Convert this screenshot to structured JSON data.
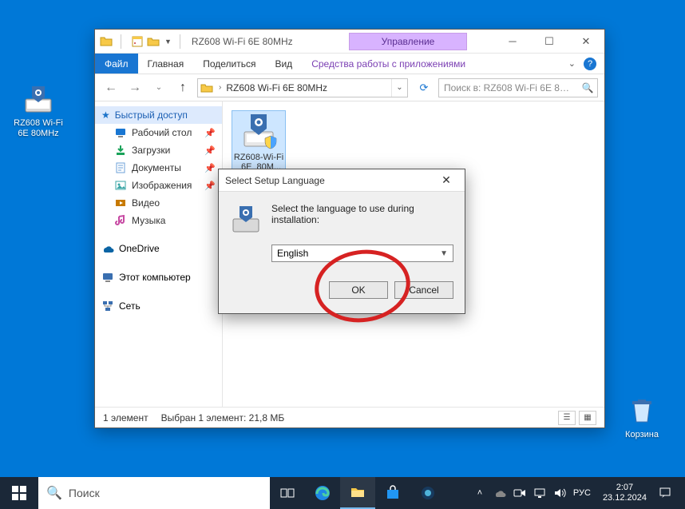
{
  "desktop": {
    "shortcut_label": "RZ608 Wi-Fi 6E 80MHz",
    "recycle_bin_label": "Корзина"
  },
  "explorer": {
    "title": "RZ608 Wi-Fi 6E 80MHz",
    "context_tab_header": "Управление",
    "tabs": {
      "file": "Файл",
      "home": "Главная",
      "share": "Поделиться",
      "view": "Вид",
      "context": "Средства работы с приложениями"
    },
    "address_segment": "RZ608 Wi-Fi 6E 80MHz",
    "search_placeholder": "Поиск в: RZ608 Wi-Fi 6E 80M...",
    "nav": {
      "quick_access": "Быстрый доступ",
      "items": [
        {
          "label": "Рабочий стол",
          "icon": "desktop-icon",
          "color": "#1976d2"
        },
        {
          "label": "Загрузки",
          "icon": "downloads-icon",
          "color": "#1aa35a"
        },
        {
          "label": "Документы",
          "icon": "documents-icon",
          "color": "#6ea2d8"
        },
        {
          "label": "Изображения",
          "icon": "pictures-icon",
          "color": "#3aa6a6"
        },
        {
          "label": "Видео",
          "icon": "video-icon",
          "color": "#c77a00"
        },
        {
          "label": "Музыка",
          "icon": "music-icon",
          "color": "#c74aa3"
        }
      ],
      "onedrive": "OneDrive",
      "this_pc": "Этот компьютер",
      "network": "Сеть"
    },
    "file_item_name": "RZ608-Wi-Fi_6E_80M...",
    "status_count": "1 элемент",
    "status_selection": "Выбран 1 элемент: 21,8 МБ"
  },
  "dialog": {
    "title": "Select Setup Language",
    "message": "Select the language to use during installation:",
    "selected_language": "English",
    "ok_label": "OK",
    "cancel_label": "Cancel"
  },
  "taskbar": {
    "search_placeholder": "Поиск",
    "lang": "РУС",
    "time": "2:07",
    "date": "23.12.2024"
  }
}
